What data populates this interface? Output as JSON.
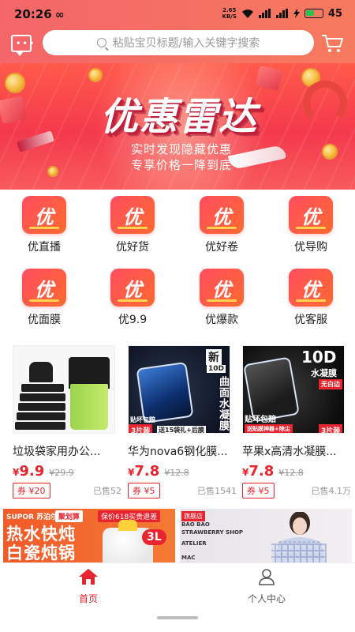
{
  "status_bar": {
    "time": "20:26",
    "infinity": "∞",
    "net_speed_value": "2.65",
    "net_speed_unit": "KB/S",
    "battery": "45"
  },
  "header": {
    "search_placeholder": "粘贴宝贝标题/输入关键字搜索",
    "left_icon": "message-icon",
    "right_icon": "cart-icon"
  },
  "banner": {
    "title": "优惠雷达",
    "subtitle_line1": "实时发现隐藏优惠",
    "subtitle_line2": "专享价格一降到底",
    "pager": {
      "count": 3,
      "active": 1
    }
  },
  "categories": [
    {
      "icon_text": "优",
      "label": "优直播"
    },
    {
      "icon_text": "优",
      "label": "优好货"
    },
    {
      "icon_text": "优",
      "label": "优好卷"
    },
    {
      "icon_text": "优",
      "label": "优导购"
    },
    {
      "icon_text": "优",
      "label": "优面膜"
    },
    {
      "icon_text": "优",
      "label": "优9.9"
    },
    {
      "icon_text": "优",
      "label": "优爆款"
    },
    {
      "icon_text": "优",
      "label": "优客服"
    }
  ],
  "products": [
    {
      "name": "垃圾袋家用办公...",
      "currency": "¥",
      "price": "9.9",
      "original_price": "¥29.9",
      "coupon": "券 ¥20",
      "sold": "已售52",
      "image_text": {}
    },
    {
      "name": "华为nova6钢化膜...",
      "currency": "¥",
      "price": "7.8",
      "original_price": "¥12.8",
      "coupon": "券 ¥5",
      "sold": "已售1541",
      "image_text": {
        "badge": "新",
        "badge2": "10D",
        "vertical": "曲面水凝膜",
        "tag_left": "贴坏包赔",
        "tag_pack": "3片装",
        "tag_gift": "送15袋礼+后膜"
      }
    },
    {
      "name": "苹果x高清水凝膜...",
      "currency": "¥",
      "price": "7.8",
      "original_price": "¥12.8",
      "coupon": "券 ¥5",
      "sold": "已售4.1万",
      "image_text": {
        "big": "10D",
        "sub": "水凝膜",
        "corner": "无白边",
        "tag_left": "贴坏包赔",
        "tag_gift": "送贴膜神器+除尘",
        "tag_pack": "3片装"
      }
    }
  ],
  "promos": [
    {
      "brand": "SUPOR 苏泊尔",
      "tag1": "聚划算",
      "tag2": "保价618买贵退差",
      "line1": "热水快炖",
      "line2": "白瓷炖锅",
      "badge": "3L"
    },
    {
      "tag": "旗舰店",
      "text1": "BAO BAO",
      "text2": "STRAWBERRY SHOP",
      "text3": "ATELIER",
      "text4": "MAC"
    }
  ],
  "tabbar": {
    "home": "首页",
    "me": "个人中心",
    "active_color": "#e8242f"
  },
  "colors": {
    "accent": "#e8242f",
    "header_start": "#f4666a",
    "header_end": "#f67a5e"
  }
}
